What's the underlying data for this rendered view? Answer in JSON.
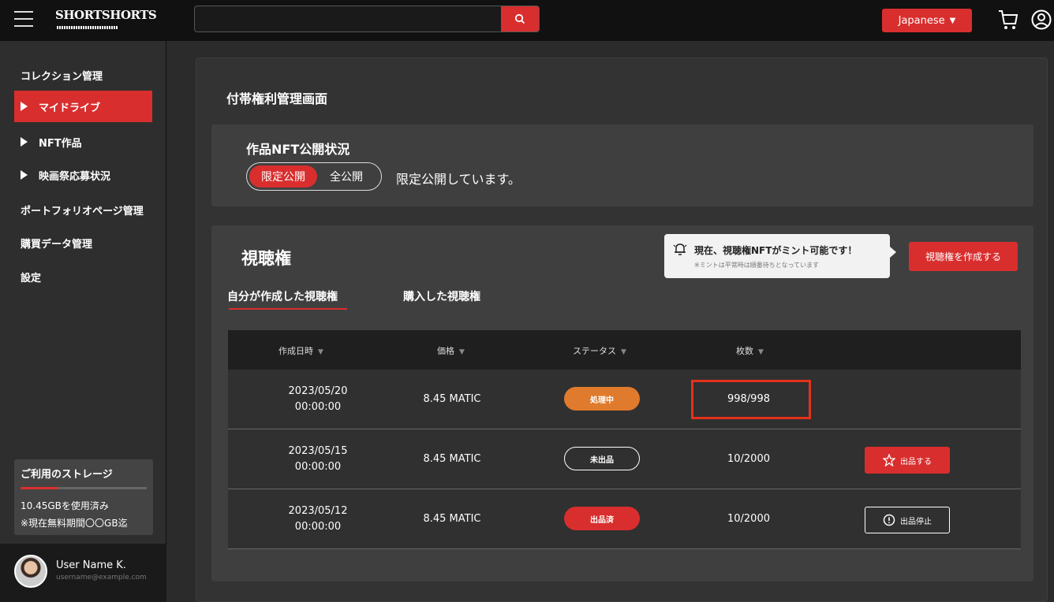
{
  "header": {
    "logo": "SHORTSHORTS",
    "search": {
      "value": "",
      "placeholder": ""
    },
    "language": "Japanese"
  },
  "sidebar": {
    "items": [
      {
        "label": "コレクション管理"
      },
      {
        "label": "マイドライブ",
        "active": true
      },
      {
        "label": "NFT作品"
      },
      {
        "label": "映画祭応募状況"
      },
      {
        "label": "ポートフォリオページ管理"
      },
      {
        "label": "購買データ管理"
      },
      {
        "label": "設定"
      }
    ],
    "storage": {
      "title": "ご利用のストレージ",
      "used": "10.45GBを使用済み",
      "note": "※現在無料期間〇〇GB迄",
      "fill_fraction": 0.3
    },
    "user": {
      "name": "User Name K.",
      "email": "username@example.com"
    }
  },
  "main": {
    "page_title": "付帯権利管理画面",
    "publish": {
      "title": "作品NFT公開状況",
      "option_limited": "限定公開",
      "option_public": "全公開",
      "status_text": "限定公開しています。"
    },
    "rights": {
      "title": "視聴権",
      "notice_main": "現在、視聴権NFTがミント可能です！",
      "notice_sub": "※ミントは平常時は順番待ちとなっています",
      "create_button": "視聴権を作成する",
      "tabs": [
        "自分が作成した視聴権",
        "購入した視聴権"
      ],
      "columns": [
        "作成日時",
        "価格",
        "ステータス",
        "枚数"
      ],
      "rows": [
        {
          "date": "2023/05/20",
          "time": "00:00:00",
          "price": "8.45 MATIC",
          "status": "処理中",
          "count": "998/998",
          "action": ""
        },
        {
          "date": "2023/05/15",
          "time": "00:00:00",
          "price": "8.45 MATIC",
          "status": "未出品",
          "count": "10/2000",
          "action": "出品する"
        },
        {
          "date": "2023/05/12",
          "time": "00:00:00",
          "price": "8.45 MATIC",
          "status": "出品済",
          "count": "10/2000",
          "action": "出品停止"
        }
      ]
    }
  },
  "colors": {
    "accent": "#d92e2e",
    "processing": "#e07a2d",
    "highlight": "#e4321c"
  }
}
